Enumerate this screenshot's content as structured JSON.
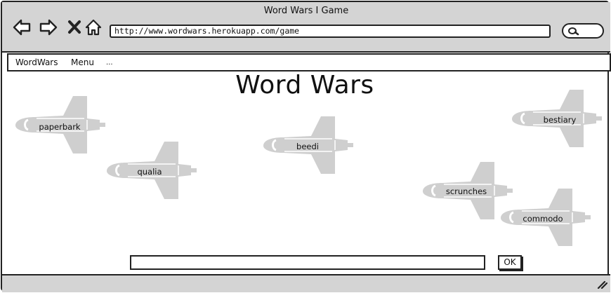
{
  "window": {
    "title": "Word Wars I Game"
  },
  "browser": {
    "url": "http://www.wordwars.herokuapp.com/game",
    "nav_icons": [
      "back-arrow-icon",
      "forward-arrow-icon",
      "close-x-icon",
      "home-icon"
    ],
    "search_icon": "search-icon"
  },
  "menubar": {
    "items": [
      "WordWars",
      "Menu",
      "..."
    ]
  },
  "game": {
    "title": "Word Wars",
    "ships": [
      {
        "word": "paperbark"
      },
      {
        "word": "qualia"
      },
      {
        "word": "beedi"
      },
      {
        "word": "bestiary"
      },
      {
        "word": "scrunches"
      },
      {
        "word": "commodo"
      }
    ],
    "input_value": "",
    "ok_label": "OK"
  },
  "colors": {
    "chrome": "#d4d4d4",
    "ship": "#cfcfcf",
    "outline": "#222222"
  }
}
